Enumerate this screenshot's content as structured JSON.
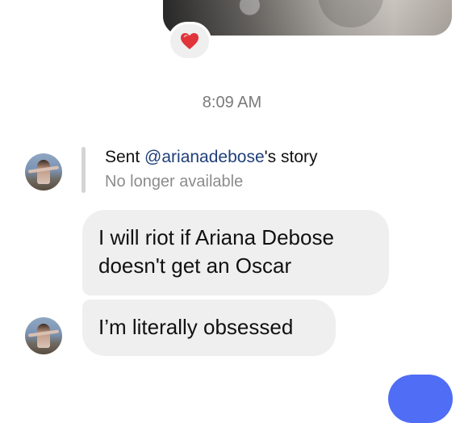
{
  "thread": {
    "timestamp": "8:09 AM",
    "reaction_emoji": "heart-icon",
    "story_share": {
      "sent_prefix": "Sent ",
      "mention": "@arianadebose",
      "suffix": "'s story",
      "status": "No longer available"
    },
    "messages": [
      {
        "text": "I will riot if Ariana Debose doesn't get an Oscar"
      },
      {
        "text": "I’m literally obsessed"
      }
    ]
  },
  "colors": {
    "bubble_gray": "#efefef",
    "mention_blue": "#1f3f7a",
    "sent_blue": "#4f6df5",
    "reaction_red": "#e0333a"
  }
}
